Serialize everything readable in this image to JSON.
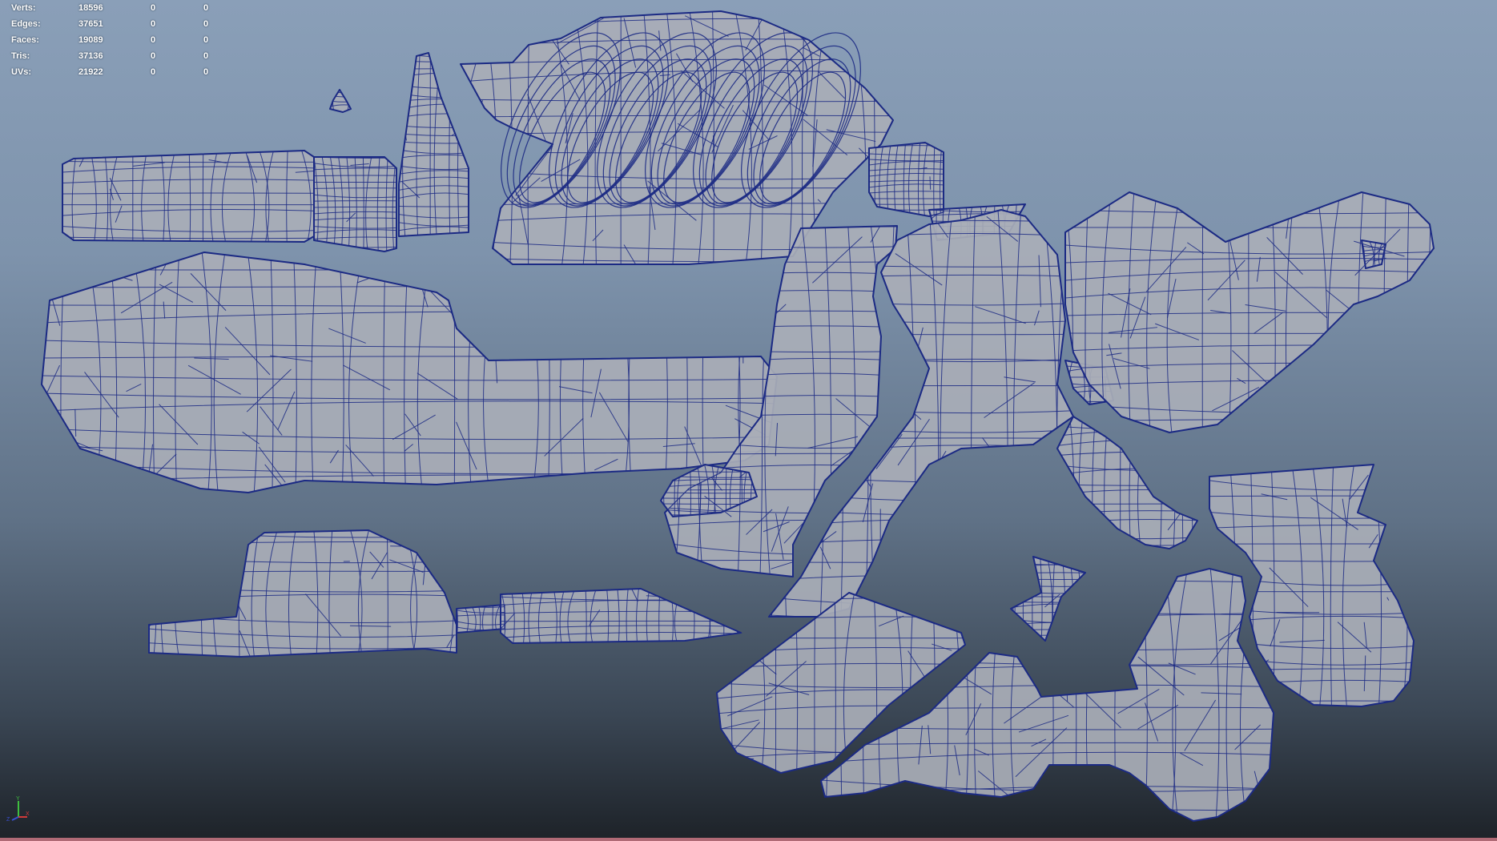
{
  "hud": {
    "rows": [
      {
        "label": "Verts:",
        "total": "18596",
        "selected": "0",
        "tri": "0"
      },
      {
        "label": "Edges:",
        "total": "37651",
        "selected": "0",
        "tri": "0"
      },
      {
        "label": "Faces:",
        "total": "19089",
        "selected": "0",
        "tri": "0"
      },
      {
        "label": "Tris:",
        "total": "37136",
        "selected": "0",
        "tri": "0"
      },
      {
        "label": "UVs:",
        "total": "21922",
        "selected": "0",
        "tri": "0"
      }
    ]
  },
  "axis": {
    "y": "Y",
    "x": "X",
    "z": "Z",
    "y_color": "#3fbf3f",
    "x_color": "#d23a3a",
    "z_color": "#3a4fd2"
  },
  "colors": {
    "wire": "#1c2a84",
    "mesh": "#a9aeb7",
    "bg_top": "#8a9fb8",
    "bg_bottom": "#1d2228",
    "status_bar": "#b06a76"
  }
}
